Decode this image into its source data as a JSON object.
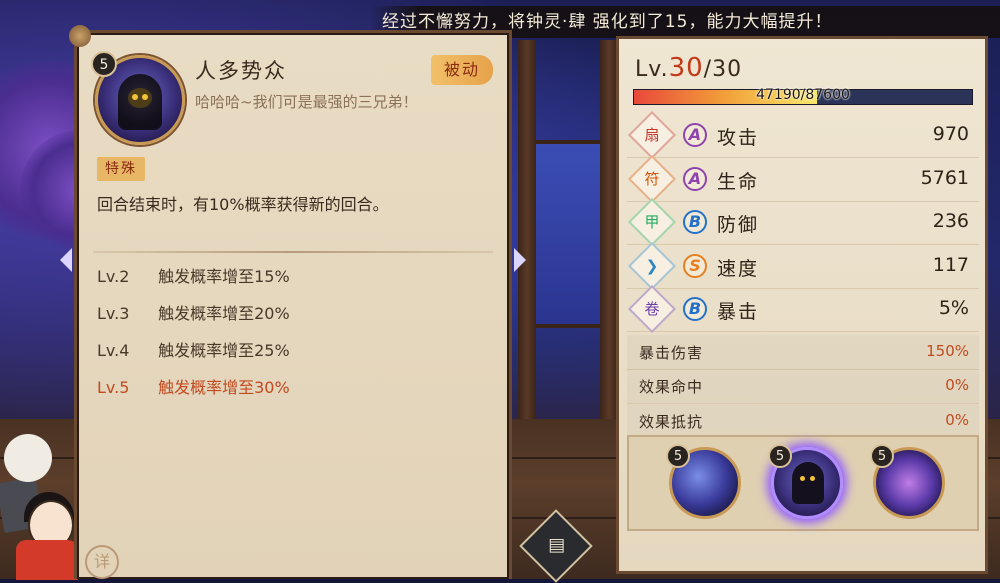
{
  "banner": {
    "text": "经过不懈努力，将钟灵·肆 强化到了15，能力大幅提升！"
  },
  "skill": {
    "level": "5",
    "name": "人多势众",
    "quote": "哈哈哈~我们可是最强的三兄弟！",
    "type_tag": "被动",
    "special_tag": "特殊",
    "description": "回合结束时，有10%概率获得新的回合。",
    "upgrades": [
      {
        "lv": "Lv.2",
        "text": "触发概率增至15%",
        "active": false
      },
      {
        "lv": "Lv.3",
        "text": "触发概率增至20%",
        "active": false
      },
      {
        "lv": "Lv.4",
        "text": "触发概率增至25%",
        "active": false
      },
      {
        "lv": "Lv.5",
        "text": "触发概率增至30%",
        "active": true
      }
    ],
    "detail_button": "详"
  },
  "status": {
    "level_prefix": "Lv.",
    "level_current": "30",
    "level_max": "/30",
    "xp_text": "47190/87600",
    "xp_fraction": 0.54
  },
  "stats": [
    {
      "icon": "fan-icon",
      "glyph": "扇",
      "icon_color": "#c0392b",
      "grade": "A",
      "grade_color": "#8e44ad",
      "name": "攻击",
      "value": "970"
    },
    {
      "icon": "talisman-icon",
      "glyph": "符",
      "icon_color": "#d35400",
      "grade": "A",
      "grade_color": "#8e44ad",
      "name": "生命",
      "value": "5761"
    },
    {
      "icon": "armor-icon",
      "glyph": "甲",
      "icon_color": "#27ae60",
      "grade": "B",
      "grade_color": "#2471c8",
      "name": "防御",
      "value": "236"
    },
    {
      "icon": "chevron-icon",
      "glyph": "❯",
      "icon_color": "#2e86c1",
      "grade": "S",
      "grade_color": "#e67e22",
      "name": "速度",
      "value": "117"
    },
    {
      "icon": "scroll-icon",
      "glyph": "卷",
      "icon_color": "#6c3fa8",
      "grade": "B",
      "grade_color": "#2471c8",
      "name": "暴击",
      "value": "5%"
    }
  ],
  "sub_stats": [
    {
      "name": "暴击伤害",
      "value": "150%"
    },
    {
      "name": "效果命中",
      "value": "0%"
    },
    {
      "name": "效果抵抗",
      "value": "0%"
    }
  ],
  "skill_tray": [
    {
      "level": "5",
      "name": "skill-1-icon"
    },
    {
      "level": "5",
      "name": "skill-2-icon"
    },
    {
      "level": "5",
      "name": "skill-3-icon"
    }
  ],
  "chat_button": {
    "glyph": "▤"
  }
}
